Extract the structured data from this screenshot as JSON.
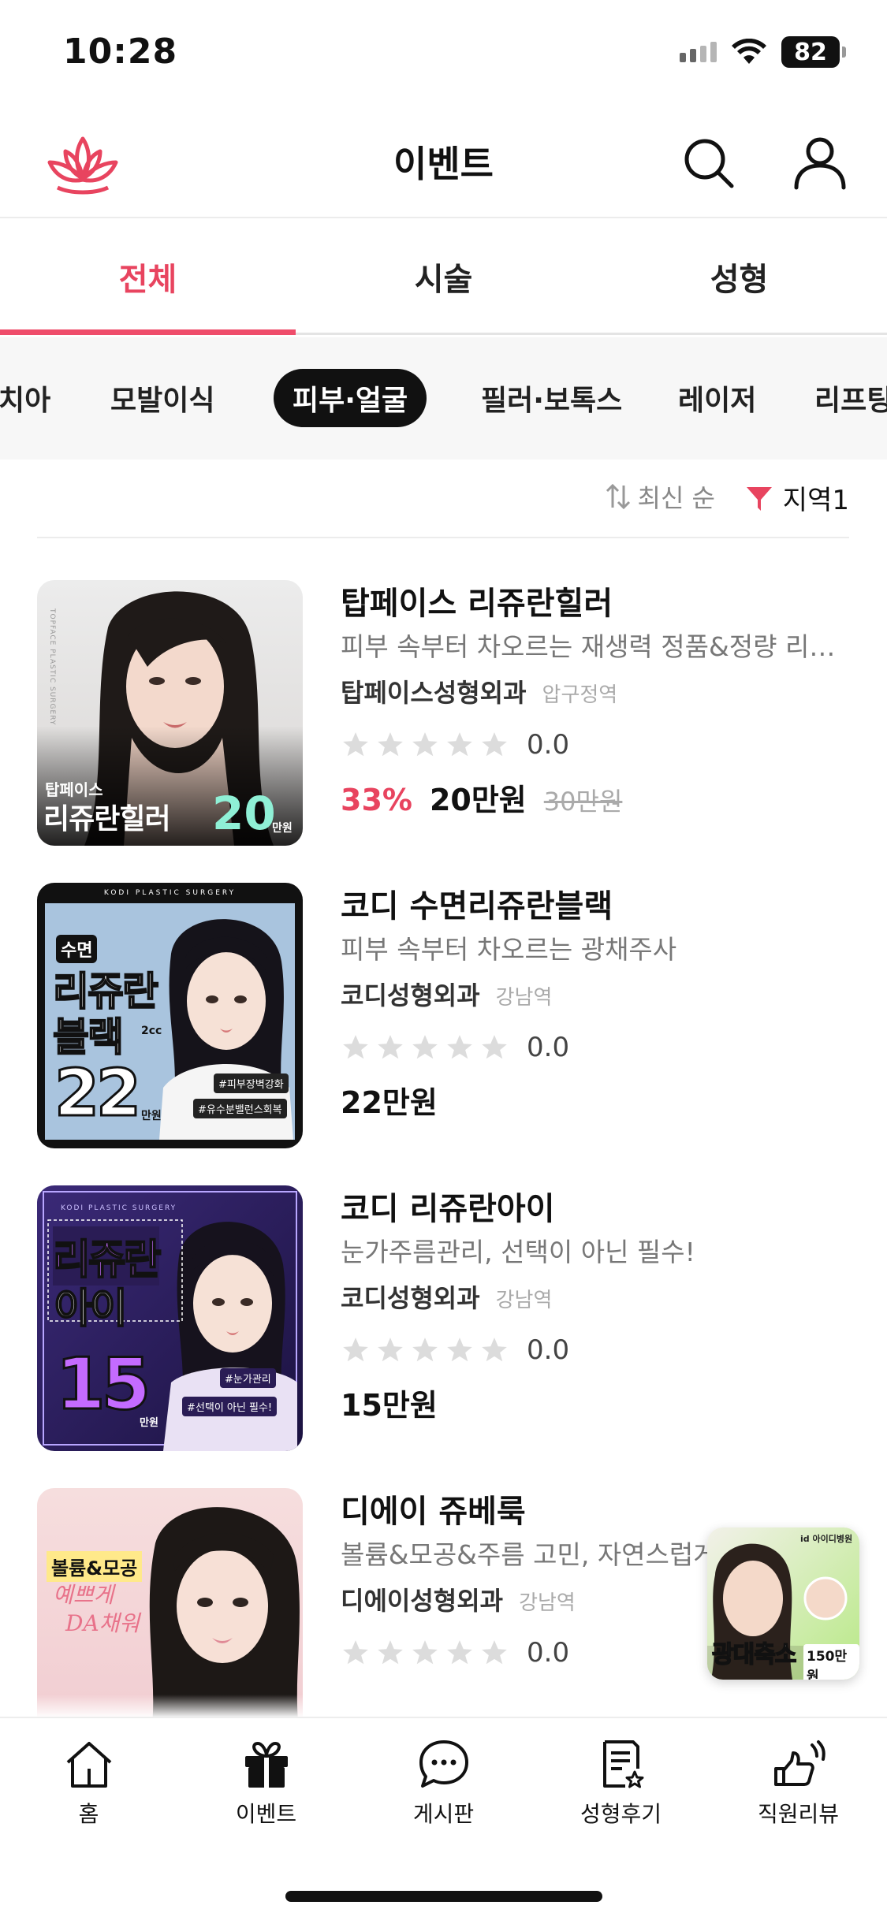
{
  "status_bar": {
    "time": "10:28",
    "battery": "82"
  },
  "header": {
    "title": "이벤트"
  },
  "main_tabs": [
    {
      "label": "전체",
      "active": true
    },
    {
      "label": "시술",
      "active": false
    },
    {
      "label": "성형",
      "active": false
    }
  ],
  "categories": [
    {
      "label": "치아",
      "active": false
    },
    {
      "label": "모발이식",
      "active": false
    },
    {
      "label": "피부·얼굴",
      "active": true
    },
    {
      "label": "필러·보톡스",
      "active": false
    },
    {
      "label": "레이저",
      "active": false
    },
    {
      "label": "리프팅",
      "active": false
    }
  ],
  "sort": {
    "label": "최신 순",
    "region_label": "지역1"
  },
  "events": [
    {
      "title": "탑페이스 리쥬란힐러",
      "description": "피부 속부터 차오르는 재생력 정품&정량 리쥬...",
      "hospital": "탑페이스성형외과",
      "station": "압구정역",
      "rating": "0.0",
      "discount": "33%",
      "price": "20만원",
      "original_price": "30만원",
      "thumb": {
        "top_text": "TOPFACE PLASTIC SURGERY",
        "brand": "탑페이스",
        "name": "리쥬란힐러",
        "price": "20",
        "unit": "만원"
      }
    },
    {
      "title": "코디 수면리쥬란블랙",
      "description": "피부 속부터 차오르는 광채주사",
      "hospital": "코디성형외과",
      "station": "강남역",
      "rating": "0.0",
      "discount": "",
      "price": "22만원",
      "original_price": "",
      "thumb": {
        "top_text": "KODI PLASTIC SURGERY",
        "tag": "수면",
        "line1": "리쥬란",
        "line2": "블랙",
        "sub": "2cc",
        "price": "22",
        "unit": "만원",
        "hash1": "#피부장벽강화",
        "hash2": "#유수분밸런스회복"
      }
    },
    {
      "title": "코디 리쥬란아이",
      "description": "눈가주름관리, 선택이 아닌 필수!",
      "hospital": "코디성형외과",
      "station": "강남역",
      "rating": "0.0",
      "discount": "",
      "price": "15만원",
      "original_price": "",
      "thumb": {
        "top_text": "KODI PLASTIC SURGERY",
        "line1": "리쥬란",
        "line2": "아이",
        "price": "15",
        "unit": "만원",
        "hash1": "#눈가관리",
        "hash2": "#선택이 아닌 필수!"
      }
    },
    {
      "title": "디에이 쥬베룩",
      "description": "볼륨&모공&주름 고민, 자연스럽게",
      "hospital": "디에이성형외과",
      "station": "강남역",
      "rating": "0.0",
      "discount": "",
      "price": "",
      "original_price": "",
      "thumb": {
        "label": "볼륨&모공",
        "script1": "예쁘게",
        "script2": "DA채워"
      }
    }
  ],
  "floating_ad": {
    "brand": "id 아이디병원",
    "title": "광대축소",
    "price": "150만원"
  },
  "bottom_nav": [
    {
      "label": "홈",
      "icon": "home-icon"
    },
    {
      "label": "이벤트",
      "icon": "gift-icon"
    },
    {
      "label": "게시판",
      "icon": "chat-icon"
    },
    {
      "label": "성형후기",
      "icon": "review-icon"
    },
    {
      "label": "직원리뷰",
      "icon": "staff-review-icon"
    }
  ],
  "colors": {
    "accent": "#e8445f",
    "chip_active": "#111111",
    "text": "#111111",
    "muted": "#888888"
  }
}
